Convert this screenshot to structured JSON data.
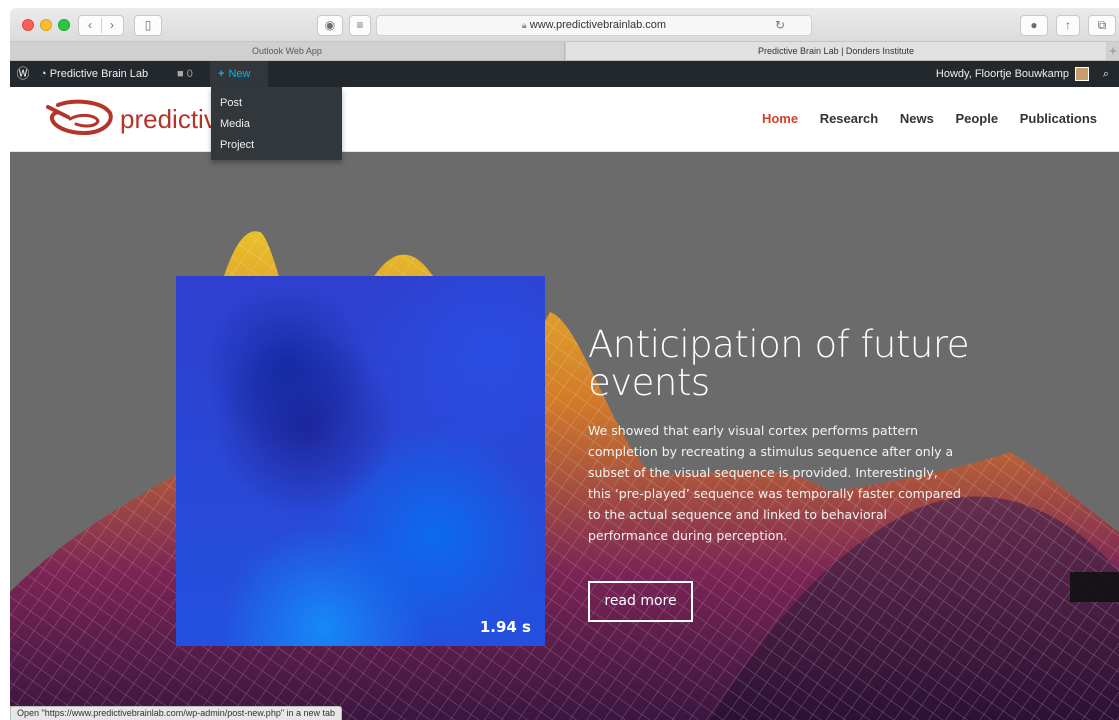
{
  "browser": {
    "address": "www.predictivebrainlab.com",
    "tabs": [
      {
        "label": "Outlook Web App"
      },
      {
        "label": "Predictive Brain Lab | Donders Institute"
      }
    ],
    "status_text": "Open \"https://www.predictivebrainlab.com/wp-admin/post-new.php\" in a new tab"
  },
  "adminbar": {
    "site_name": "Predictive Brain Lab",
    "comments_count": "0",
    "new_label": "New",
    "howdy": "Howdy, Floortje Bouwkamp",
    "new_menu": [
      {
        "label": "Post"
      },
      {
        "label": "Media"
      },
      {
        "label": "Project"
      }
    ]
  },
  "site": {
    "logo_text": "predictive",
    "nav": [
      {
        "label": "Home",
        "active": true
      },
      {
        "label": "Research"
      },
      {
        "label": "News"
      },
      {
        "label": "People"
      },
      {
        "label": "Publications"
      }
    ]
  },
  "hero": {
    "title": "Anticipation of future events",
    "text": "We showed that early visual cortex performs pattern completion by recreating a stimulus sequence after only a subset of the visual sequence is provided. Interestingly, this ‘pre-played’ sequence was temporally faster compared to the actual sequence and linked to behavioral performance during perception.",
    "button": "read more",
    "time_label": "1.94 s"
  },
  "colors": {
    "accent": "#d1402a",
    "adminbar": "#23282d",
    "wp_blue": "#00b9eb"
  }
}
